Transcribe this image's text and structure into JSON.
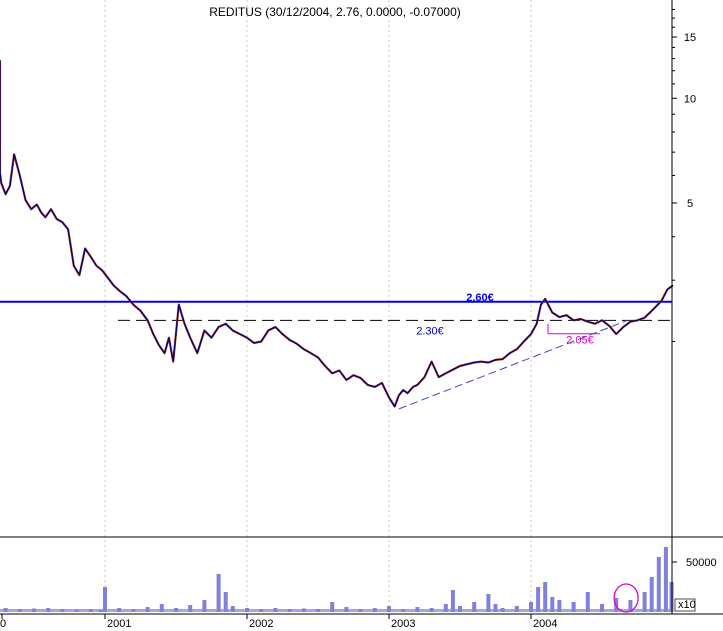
{
  "chart_data": {
    "type": "line",
    "title": "REDITUS (30/12/2004, 2.76, 0.0000, -0.07000)",
    "price_scale": "log",
    "y_ticks": [
      {
        "value": 15,
        "label": "15"
      },
      {
        "value": 10,
        "label": "10"
      },
      {
        "value": 5,
        "label": "5"
      }
    ],
    "x_ticks": [
      {
        "value": 2000.0,
        "label": "0"
      },
      {
        "value": 2001.0,
        "label": "2001"
      },
      {
        "value": 2002.0,
        "label": "2002"
      },
      {
        "value": 2003.0,
        "label": "2003"
      },
      {
        "value": 2004.0,
        "label": "2004"
      }
    ],
    "volume_ticks": [
      {
        "value": 50000,
        "label": "50000"
      }
    ],
    "volume_multiplier_label": "x10",
    "xlim": [
      2000.0,
      2005.0
    ],
    "ylim": [
      1.25,
      18
    ],
    "grid": "vertical dashed",
    "colors": {
      "price_line": "#000080",
      "price_accent": "#b04010",
      "resistance": "#0000ee",
      "support": "#000000",
      "support_label": "#0000cc",
      "low_label": "#dd00cc",
      "trendline": "#4444cc",
      "volume": "#8080dd"
    },
    "annotations": {
      "resistance_label": "2.60€",
      "resistance_value": 2.6,
      "support_label": "2.30€",
      "support_value": 2.3,
      "low_label": "2.05€",
      "low_value": 2.05
    },
    "series": [
      {
        "x": [
          2000.0,
          2000.02,
          2000.04,
          2000.07,
          2000.1,
          2000.13,
          2000.16,
          2000.2,
          2000.24,
          2000.27,
          2000.3,
          2000.33,
          2000.36,
          2000.4,
          2000.44,
          2000.48,
          2000.52,
          2000.55,
          2000.58,
          2000.62,
          2000.66,
          2000.7,
          2000.74,
          2000.78,
          2000.82,
          2000.86,
          2000.9,
          2000.94,
          2000.98,
          2001.02,
          2001.06,
          2001.1,
          2001.15,
          2001.2,
          2001.25,
          2001.3,
          2001.34,
          2001.38,
          2001.42,
          2001.45,
          2001.48,
          2001.52,
          2001.56,
          2001.6,
          2001.65,
          2001.7,
          2001.75,
          2001.8,
          2001.85,
          2001.9,
          2001.95,
          2002.0,
          2002.05,
          2002.1,
          2002.15,
          2002.2,
          2002.25,
          2002.3,
          2002.35,
          2002.4,
          2002.45,
          2002.5,
          2002.55,
          2002.6,
          2002.65,
          2002.7,
          2002.75,
          2002.8,
          2002.85,
          2002.9,
          2002.95,
          2003.0,
          2003.04,
          2003.07,
          2003.1,
          2003.13,
          2003.17,
          2003.2,
          2003.25,
          2003.3,
          2003.35,
          2003.4,
          2003.45,
          2003.5,
          2003.55,
          2003.6,
          2003.65,
          2003.7,
          2003.75,
          2003.8,
          2003.85,
          2003.9,
          2003.95,
          2004.0,
          2004.04,
          2004.07,
          2004.1,
          2004.15,
          2004.2,
          2004.25,
          2004.3,
          2004.35,
          2004.4,
          2004.45,
          2004.5,
          2004.55,
          2004.6,
          2004.65,
          2004.7,
          2004.75,
          2004.8,
          2004.85,
          2004.88,
          2004.92,
          2004.96,
          2005.0
        ],
        "values": [
          10.5,
          12.8,
          10.2,
          9.8,
          8.8,
          7.9,
          7.1,
          6.6,
          6.1,
          5.7,
          5.3,
          5.6,
          6.9,
          6.0,
          5.1,
          4.8,
          4.95,
          4.7,
          4.55,
          4.8,
          4.5,
          4.4,
          4.2,
          3.3,
          3.1,
          3.7,
          3.5,
          3.3,
          3.2,
          3.05,
          2.9,
          2.8,
          2.7,
          2.55,
          2.45,
          2.3,
          2.1,
          1.95,
          1.85,
          2.05,
          1.75,
          2.55,
          2.25,
          2.05,
          1.85,
          2.15,
          2.05,
          2.2,
          2.25,
          2.15,
          2.1,
          2.05,
          1.98,
          2.0,
          2.15,
          2.2,
          2.1,
          2.02,
          1.97,
          1.9,
          1.85,
          1.8,
          1.7,
          1.62,
          1.65,
          1.55,
          1.6,
          1.57,
          1.5,
          1.48,
          1.52,
          1.38,
          1.3,
          1.4,
          1.45,
          1.42,
          1.48,
          1.5,
          1.58,
          1.75,
          1.58,
          1.62,
          1.66,
          1.7,
          1.72,
          1.74,
          1.75,
          1.74,
          1.77,
          1.78,
          1.85,
          1.9,
          2.0,
          2.1,
          2.25,
          2.55,
          2.65,
          2.42,
          2.35,
          2.38,
          2.3,
          2.32,
          2.28,
          2.25,
          2.3,
          2.22,
          2.1,
          2.2,
          2.28,
          2.3,
          2.34,
          2.45,
          2.52,
          2.62,
          2.82,
          2.9
        ]
      }
    ],
    "volume": {
      "x": [
        2000.0,
        2000.1,
        2000.2,
        2000.3,
        2000.4,
        2000.5,
        2000.6,
        2000.7,
        2000.8,
        2000.9,
        2000.97,
        2001.0,
        2001.1,
        2001.2,
        2001.3,
        2001.4,
        2001.5,
        2001.6,
        2001.7,
        2001.8,
        2001.85,
        2001.9,
        2002.0,
        2002.1,
        2002.2,
        2002.3,
        2002.4,
        2002.5,
        2002.6,
        2002.7,
        2002.8,
        2002.9,
        2003.0,
        2003.1,
        2003.2,
        2003.3,
        2003.4,
        2003.45,
        2003.5,
        2003.6,
        2003.7,
        2003.75,
        2003.8,
        2003.9,
        2004.0,
        2004.05,
        2004.1,
        2004.15,
        2004.2,
        2004.3,
        2004.4,
        2004.5,
        2004.6,
        2004.7,
        2004.8,
        2004.85,
        2004.9,
        2004.95,
        2004.99
      ],
      "values": [
        5000,
        6000,
        3000,
        4000,
        3000,
        3500,
        4000,
        3000,
        2500,
        3000,
        2000,
        25000,
        4000,
        3000,
        5000,
        8000,
        4000,
        7000,
        12000,
        38000,
        20000,
        6000,
        4000,
        3000,
        4000,
        3000,
        3500,
        3000,
        10000,
        5000,
        3000,
        4000,
        6000,
        3000,
        5000,
        4000,
        8000,
        22000,
        6000,
        10000,
        18000,
        8000,
        4000,
        6000,
        10000,
        25000,
        30000,
        15000,
        12000,
        10000,
        20000,
        8000,
        14000,
        12000,
        20000,
        35000,
        55000,
        65000,
        30000
      ]
    }
  }
}
